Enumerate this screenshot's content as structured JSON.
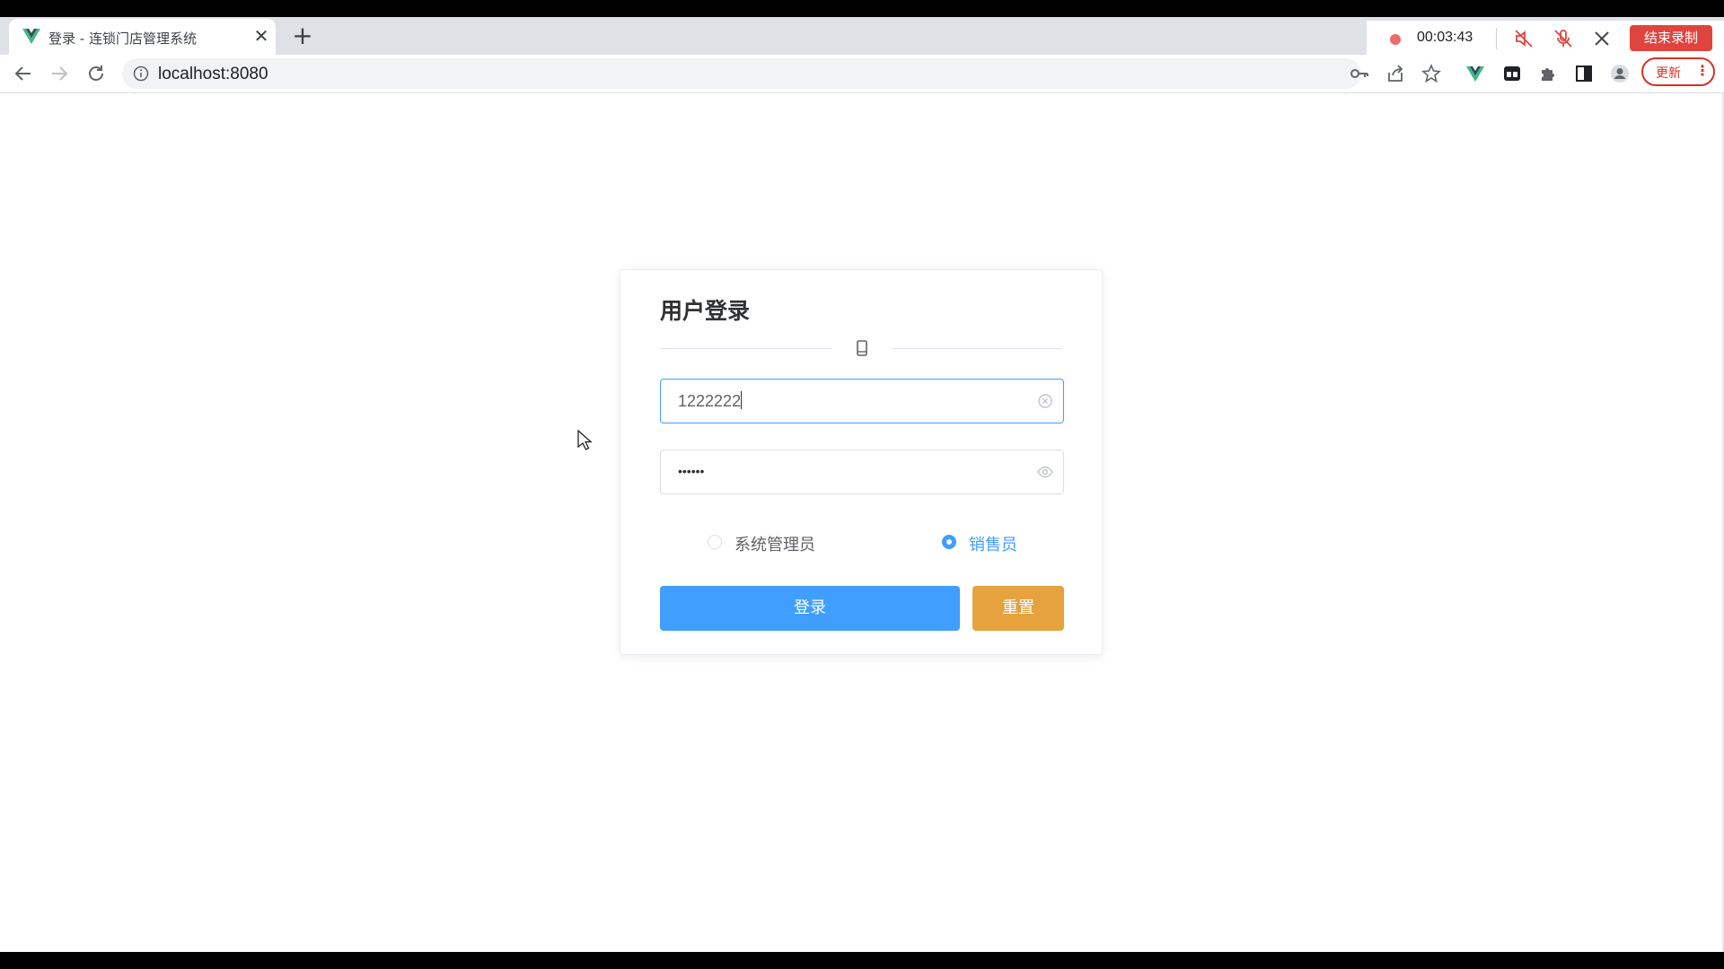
{
  "browser": {
    "tab": {
      "title": "登录 - 连锁门店管理系统",
      "close_glyph": "✕",
      "favicon": "vue-logo-icon"
    },
    "new_tab_glyph": "+",
    "url": "localhost:8080",
    "update_label": "更新",
    "menu_glyph": "⋮"
  },
  "recorder": {
    "timer": "00:03:43",
    "stop_label": "结束录制"
  },
  "login": {
    "title": "用户登录",
    "username_value": "1222222",
    "password_mask": "••••••",
    "roles": [
      {
        "label": "系统管理员",
        "selected": false
      },
      {
        "label": "销售员",
        "selected": true
      }
    ],
    "login_button": "登录",
    "reset_button": "重置"
  },
  "colors": {
    "primary": "#409eff",
    "warning": "#e6a23c",
    "record_red": "#e0443e"
  }
}
